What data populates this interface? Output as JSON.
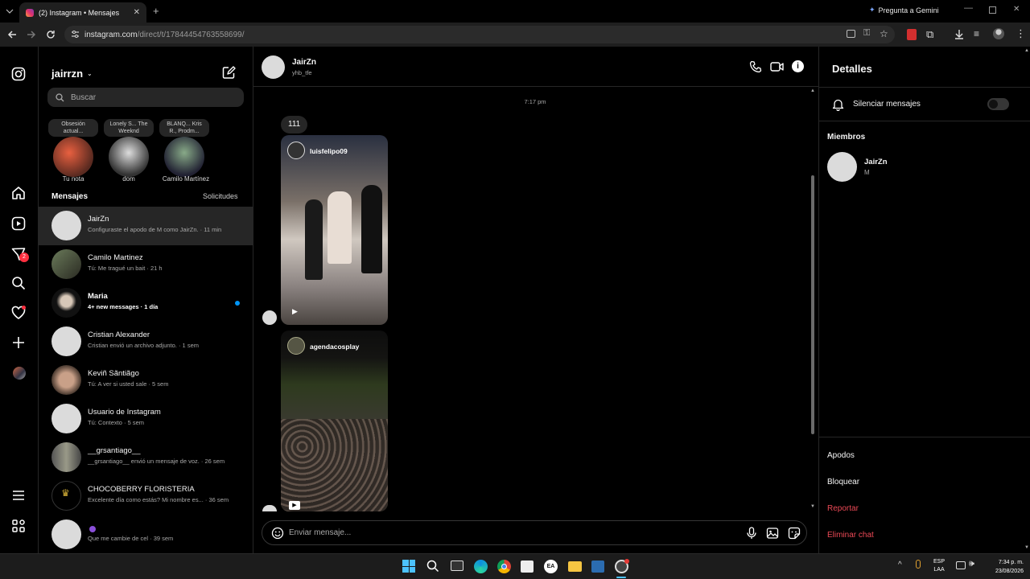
{
  "browser": {
    "tab_title": "(2) Instagram • Mensajes",
    "new_tab": "+",
    "gemini": "Pregunta a Gemini",
    "url_host": "instagram.com",
    "url_path": "/direct/t/17844454763558699/"
  },
  "inbox": {
    "username": "jairrzn",
    "search_placeholder": "Buscar",
    "notes": [
      {
        "bubble": "Obsesión actual...",
        "label": "Tu nota"
      },
      {
        "bubble": "Lonely S... The Weeknd",
        "label": "dom"
      },
      {
        "bubble": "BLANQ... Kris R., Prodm...",
        "label": "Camilo Martínez"
      }
    ],
    "messages_title": "Mensajes",
    "requests_label": "Solicitudes",
    "conversations": [
      {
        "name": "JairZn",
        "preview": "Configuraste el apodo de M como JairZn. · 11 min"
      },
      {
        "name": "Camilo Martinez",
        "preview": "Tú: Me tragué un bait · 21 h"
      },
      {
        "name": "Maria",
        "preview": "4+ new messages · 1 día"
      },
      {
        "name": "Cristian Alexander",
        "preview": "Cristian envió un archivo adjunto. · 1 sem"
      },
      {
        "name": "Keviñ Sãntiãgo",
        "preview": "Tú: A ver si usted sale · 5 sem"
      },
      {
        "name": "Usuario de Instagram",
        "preview": "Tú: Contexto · 5 sem"
      },
      {
        "name": "__grsantiago__",
        "preview": "__grsantiago__ envió un mensaje de voz. · 26 sem"
      },
      {
        "name": "CHOCOBERRY FLORISTERIA",
        "preview": "Excelente día como estás? Mi nombre es... · 36 sem"
      },
      {
        "name": "",
        "preview": "Que me cambie de cel · 39 sem"
      }
    ],
    "nav_badge": "2"
  },
  "thread": {
    "name": "JairZn",
    "handle": "yhb_tfe",
    "timestamp": "7:17 pm",
    "message_text": "111",
    "posts": [
      {
        "author": "luisfelipo09"
      },
      {
        "author": "agendacosplay"
      }
    ],
    "composer_placeholder": "Enviar mensaje..."
  },
  "details": {
    "title": "Detalles",
    "mute_label": "Silenciar mensajes",
    "members_title": "Miembros",
    "member_name": "JairZn",
    "member_sub": "M",
    "nicknames": "Apodos",
    "block": "Bloquear",
    "report": "Reportar",
    "delete_chat": "Eliminar chat"
  },
  "taskbar": {
    "lang_top": "ESP",
    "lang_bottom": "LAA",
    "time": "7:34 p. m.",
    "date": "23/08/2026"
  },
  "colors": {
    "accent_blue": "#0095f6",
    "danger_red": "#ed4956",
    "badge_red": "#ff3040"
  }
}
